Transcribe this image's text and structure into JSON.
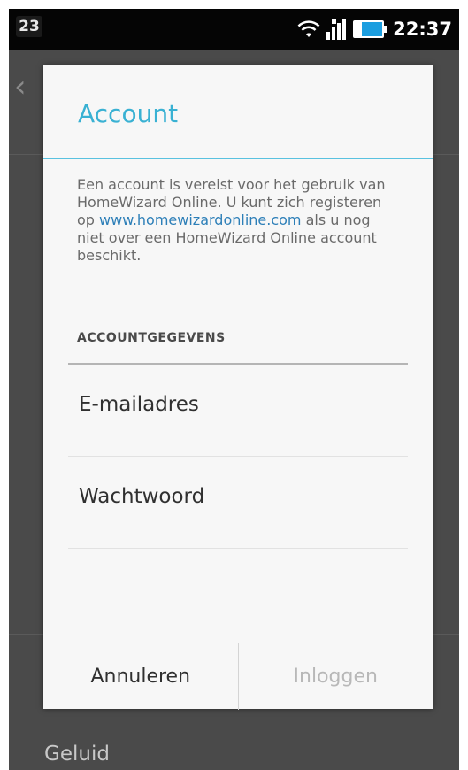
{
  "status_bar": {
    "notification_count": "23",
    "time": "22:37",
    "icons": [
      "wifi-icon",
      "signal-icon",
      "battery-icon"
    ]
  },
  "background": {
    "bottom_label": "Geluid"
  },
  "dialog": {
    "title": "Account",
    "intro_text_before_link": "Een account is vereist voor het gebruik van HomeWizard Online. U kunt zich registeren op ",
    "intro_link": "www.homewizardonline.com",
    "intro_text_after_link": " als u nog niet over een HomeWizard Online account beschikt.",
    "section_header": "ACCOUNTGEGEVENS",
    "fields": {
      "email_label": "E-mailadres",
      "password_label": "Wachtwoord"
    },
    "buttons": {
      "cancel": "Annuleren",
      "login": "Inloggen"
    }
  },
  "colors": {
    "title_accent": "#39b1d3",
    "link": "#2d7fb8",
    "disabled_button": "#b8b8b8"
  }
}
